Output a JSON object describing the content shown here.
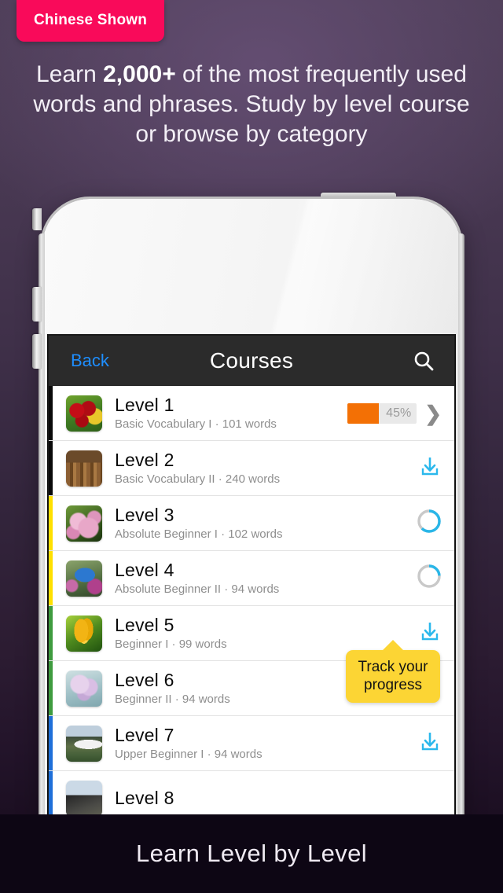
{
  "badge": {
    "label": "Chinese Shown"
  },
  "headline": {
    "part1": "Learn ",
    "emphasis": "2,000+",
    "part2": " of the most frequently used words and phrases. Study by level course or browse by category"
  },
  "footer": {
    "caption": "Learn Level by Level"
  },
  "phone": {
    "navbar": {
      "back_label": "Back",
      "title": "Courses",
      "search_icon": "search-icon"
    },
    "tooltip": {
      "text": "Track your progress"
    },
    "courses": [
      {
        "title": "Level 1",
        "subtitle": "Basic Vocabulary I · 101 words",
        "level_name": "Basic Vocabulary I",
        "word_count": "101 words",
        "accessory": "progress-bar",
        "progress_percent": 45,
        "progress_label": "45%",
        "stripe_color": "#0A0A0A",
        "thumb": "red-tulips"
      },
      {
        "title": "Level 2",
        "subtitle": "Basic Vocabulary II · 240 words",
        "level_name": "Basic Vocabulary II",
        "word_count": "240 words",
        "accessory": "download-icon",
        "stripe_color": "#0A0A0A",
        "thumb": "open-books"
      },
      {
        "title": "Level 3",
        "subtitle": "Absolute Beginner I · 102 words",
        "level_name": "Absolute Beginner I",
        "word_count": "102 words",
        "accessory": "progress-ring",
        "ring_percent": 62,
        "stripe_color": "#FFE000",
        "thumb": "pink-blossoms"
      },
      {
        "title": "Level 4",
        "subtitle": "Absolute Beginner II · 94 words",
        "level_name": "Absolute Beginner II",
        "word_count": "94 words",
        "accessory": "progress-ring",
        "ring_percent": 24,
        "stripe_color": "#FFE000",
        "thumb": "bluebird"
      },
      {
        "title": "Level 5",
        "subtitle": "Beginner I · 99 words",
        "level_name": "Beginner I",
        "word_count": "99 words",
        "accessory": "download-icon",
        "stripe_color": "#3E9B3E",
        "thumb": "yellow-crocus"
      },
      {
        "title": "Level 6",
        "subtitle": "Beginner II · 94 words",
        "level_name": "Beginner II",
        "word_count": "94 words",
        "accessory": "download-icon",
        "stripe_color": "#3E9B3E",
        "thumb": "lilac-flowers"
      },
      {
        "title": "Level 7",
        "subtitle": "Upper Beginner I · 94 words",
        "level_name": "Upper Beginner I",
        "word_count": "94 words",
        "accessory": "download-icon",
        "stripe_color": "#1E6FD9",
        "thumb": "steam-valley"
      }
    ]
  },
  "colors": {
    "badge_pink": "#F90A5A",
    "tooltip_yellow": "#FCD534",
    "progress_orange": "#F37005",
    "ring_blue": "#29B6E8",
    "download_blue": "#2BB8EC",
    "nav_back_blue": "#1E8EFF",
    "navbar_dark": "#2B2B2B",
    "footer_dark": "#0D0614"
  }
}
